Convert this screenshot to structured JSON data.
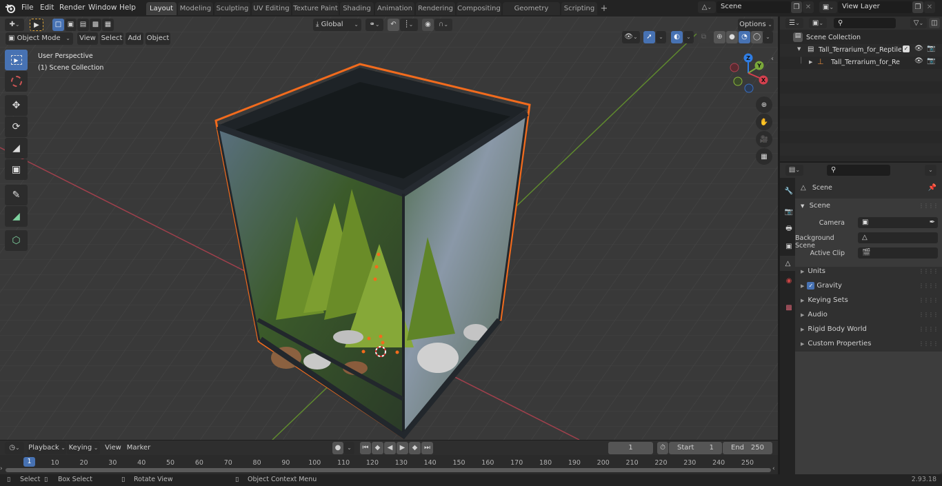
{
  "app": {
    "name": "Blender",
    "version": "2.93.18"
  },
  "menu": [
    "File",
    "Edit",
    "Render",
    "Window",
    "Help"
  ],
  "workspaces": [
    {
      "label": "Layout",
      "active": true
    },
    {
      "label": "Modeling"
    },
    {
      "label": "Sculpting"
    },
    {
      "label": "UV Editing"
    },
    {
      "label": "Texture Paint"
    },
    {
      "label": "Shading"
    },
    {
      "label": "Animation"
    },
    {
      "label": "Rendering"
    },
    {
      "label": "Compositing"
    },
    {
      "label": "Geometry Nodes"
    },
    {
      "label": "Scripting"
    }
  ],
  "add_workspace": "+",
  "scene_selector": {
    "value": "Scene"
  },
  "view_layer_selector": {
    "value": "View Layer"
  },
  "viewport": {
    "mode": "Object Mode",
    "menus": [
      "View",
      "Select",
      "Add",
      "Object"
    ],
    "transform_orientation": "Global",
    "options_label": "Options",
    "overlay_text": {
      "view": "User Perspective",
      "collection": "(1) Scene Collection"
    },
    "tools": [
      "select-box",
      "cursor",
      "move",
      "rotate",
      "scale",
      "transform",
      "annotate",
      "measure",
      "add-cube"
    ],
    "gizmo_axes": [
      "Z",
      "Y",
      "X"
    ],
    "colors": {
      "accent": "#4772b3",
      "selection_outline": "#f26b1d",
      "x_axis": "#d4404e",
      "y_axis": "#7aa83a",
      "z_axis": "#2f7ee6"
    }
  },
  "outliner": {
    "search_placeholder": "",
    "root": "Scene Collection",
    "items": [
      {
        "label": "Tall_Terrarium_for_Reptiles_w",
        "type": "collection",
        "checked": true
      },
      {
        "label": "Tall_Terrarium_for_Reptile",
        "type": "object"
      }
    ]
  },
  "properties": {
    "context": "Scene",
    "panel_title": "Scene",
    "fields": [
      {
        "label": "Camera",
        "value": ""
      },
      {
        "label": "Background Scene",
        "value": ""
      },
      {
        "label": "Active Clip",
        "value": ""
      }
    ],
    "subpanels": [
      {
        "label": "Units"
      },
      {
        "label": "Gravity",
        "checkbox": true,
        "checked": true
      },
      {
        "label": "Keying Sets"
      },
      {
        "label": "Audio"
      },
      {
        "label": "Rigid Body World"
      },
      {
        "label": "Custom Properties"
      }
    ]
  },
  "timeline": {
    "menus": [
      "Playback",
      "Keying",
      "View",
      "Marker"
    ],
    "current_frame": "1",
    "start_label": "Start",
    "start": "1",
    "end_label": "End",
    "end": "250",
    "ticks": [
      "10",
      "20",
      "30",
      "40",
      "50",
      "60",
      "70",
      "80",
      "90",
      "100",
      "110",
      "120",
      "130",
      "140",
      "150",
      "160",
      "170",
      "180",
      "190",
      "200",
      "210",
      "220",
      "230",
      "240",
      "250"
    ],
    "playhead": "1"
  },
  "statusbar": {
    "hints": [
      {
        "label": "Select"
      },
      {
        "label": "Box Select"
      },
      {
        "label": "Rotate View"
      },
      {
        "label": "Object Context Menu"
      }
    ],
    "version": "2.93.18"
  }
}
